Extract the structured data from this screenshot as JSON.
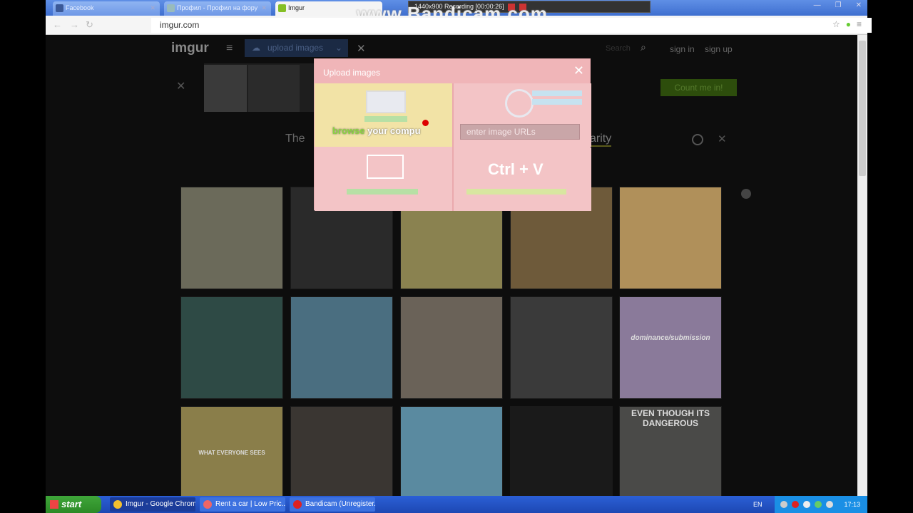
{
  "browser": {
    "tabs": [
      {
        "label": "Facebook",
        "active": false
      },
      {
        "label": "Профил - Профил на фору",
        "active": false
      },
      {
        "label": "Imgur",
        "active": true
      }
    ],
    "address": "imgur.com",
    "recording": "1440x900 Recording [00:00:26]",
    "watermark": "www.Bandicam.com"
  },
  "header": {
    "logo": "imgur",
    "upload_label": "upload images",
    "search_placeholder": "Search",
    "signin": "sign in",
    "signup": "sign up"
  },
  "banner": {
    "cta": "Count me in!"
  },
  "gallery": {
    "title_start": "The",
    "sort_label": "arity"
  },
  "thumbs": [
    {
      "caption": ""
    },
    {
      "caption": ""
    },
    {
      "caption": ""
    },
    {
      "caption": ""
    },
    {
      "caption": ""
    },
    {
      "caption": ""
    },
    {
      "caption": ""
    },
    {
      "caption": ""
    },
    {
      "caption": ""
    },
    {
      "caption": "dominance/submission"
    },
    {
      "caption": "WHAT EVERYONE SEES"
    },
    {
      "caption": ""
    },
    {
      "caption": ""
    },
    {
      "caption": ""
    },
    {
      "caption": "EVEN THOUGH ITS DANGEROUS"
    }
  ],
  "modal": {
    "title": "Upload images",
    "browse_highlight": "browse",
    "browse_rest": "your compu",
    "url_placeholder": "enter image URLs",
    "paste_label": "Ctrl + V"
  },
  "taskbar": {
    "start": "start",
    "tasks": [
      {
        "label": "Imgur - Google Chrome",
        "active": true
      },
      {
        "label": "Rent a car | Low Pric...",
        "active": false
      },
      {
        "label": "Bandicam (Unregister...",
        "active": false
      }
    ],
    "lang": "EN",
    "time": "17:13"
  },
  "colors": {
    "modal_bg": "#f3c4c6",
    "browse_accent": "#8bd440",
    "taskbar": "#1d48b3"
  }
}
